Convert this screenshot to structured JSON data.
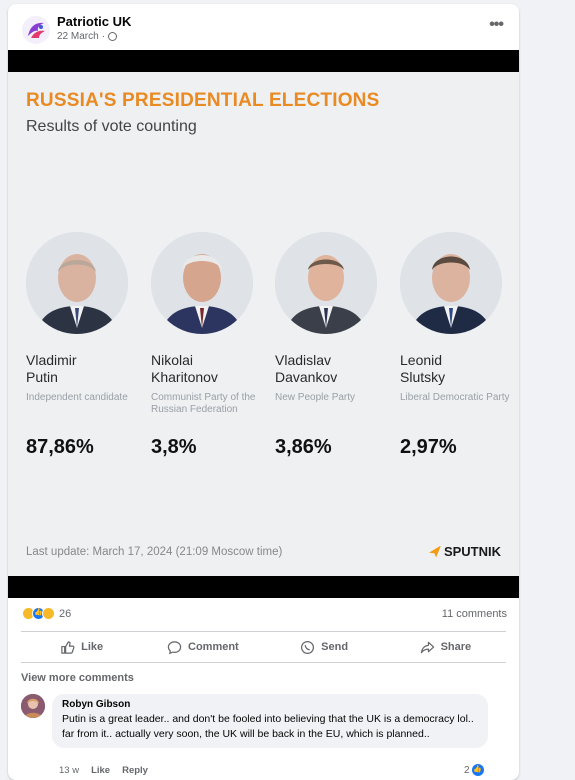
{
  "post": {
    "page_name": "Patriotic UK",
    "date": "22 March",
    "more_icon": "more-icon"
  },
  "graphic": {
    "title": "RUSSIA'S PRESIDENTIAL ELECTIONS",
    "subtitle": "Results of vote counting",
    "title_color": "#e98a22",
    "candidates": [
      {
        "first": "Vladimir",
        "last": "Putin",
        "party": "Independent candidate",
        "percent": "87,86%"
      },
      {
        "first": "Nikolai",
        "last": "Kharitonov",
        "party": "Communist Party of the Russian Federation",
        "percent": "3,8%"
      },
      {
        "first": "Vladislav",
        "last": "Davankov",
        "party": "New People Party",
        "percent": "3,86%"
      },
      {
        "first": "Leonid",
        "last": "Slutsky",
        "party": "Liberal Democratic Party",
        "percent": "2,97%"
      }
    ],
    "last_update": "Last update: March 17, 2024 (21:09 Moscow time)",
    "brand": "SPUTNIK"
  },
  "stats": {
    "reaction_count": "26",
    "comment_count": "11 comments"
  },
  "actions": {
    "like": "Like",
    "comment": "Comment",
    "send": "Send",
    "share": "Share"
  },
  "comments": {
    "view_more": "View more comments",
    "items": [
      {
        "author": "Robyn Gibson",
        "text": "Putin is a great leader.. and don't be fooled into believing that the UK is a democracy lol.. far from it.. actually very soon, the UK will be back in the EU, which is planned..",
        "age": "13 w",
        "like": "Like",
        "reply": "Reply",
        "likes": "2"
      }
    ]
  }
}
